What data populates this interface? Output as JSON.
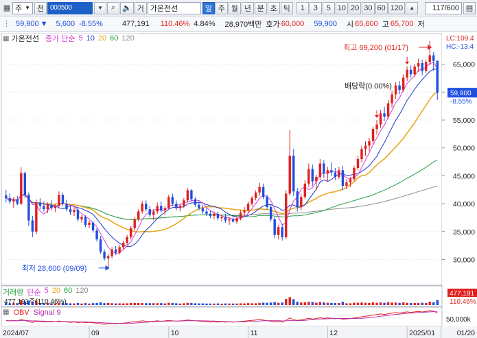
{
  "toolbar": {
    "market": "주",
    "period_label": "전",
    "code": "000500",
    "type": "거",
    "stock_name": "가온전선",
    "periods": [
      "일",
      "주",
      "월",
      "년",
      "분",
      "초",
      "틱"
    ],
    "active_period": "일",
    "intervals": [
      "1",
      "3",
      "5",
      "10",
      "20",
      "30",
      "60",
      "120"
    ],
    "count": "117/600"
  },
  "info": {
    "price": "59,900",
    "change": "5,600",
    "change_pct": "-8.55%",
    "volume": "477,191",
    "vol_ratio": "110.46%",
    "turnover": "4.84%",
    "amount": "28,970백만",
    "ask_label": "호가",
    "ask": "60,000",
    "bid": "59,900",
    "open_label": "시",
    "open": "65,600",
    "high_label": "고",
    "high": "65,700",
    "low_label": "저"
  },
  "legend": {
    "title": "가온전선",
    "ma_label": "종가 단순",
    "ma_periods": [
      "5",
      "10",
      "20",
      "60",
      "120"
    ]
  },
  "annotations": {
    "high": "최고 69,200 (01/17)",
    "low": "최저 28,600 (09/09)",
    "dividend": "배당락(0.00%)",
    "lc": "LC:109.4",
    "hc": "HC:-13.4"
  },
  "price_badge": {
    "price": "59,900",
    "pct": "-8.55%"
  },
  "volume": {
    "title": "거래량",
    "ma_label": "단순",
    "ma_periods": [
      "5",
      "20",
      "60",
      "120"
    ],
    "value_text": "477,191주(110.46%)",
    "badge_value": "477,191",
    "badge_pct": "110.46%"
  },
  "obv": {
    "title": "OBV",
    "signal": "Signal 9",
    "axis_label": "50,000k"
  },
  "colors": {
    "up": "#e0201f",
    "down": "#1f4ee0",
    "ma5": "#d43fd4",
    "ma10": "#2238c8",
    "ma20": "#e8a81c",
    "ma60": "#27a043",
    "ma120": "#8c8c8c"
  },
  "chart_data": {
    "type": "candlestick",
    "y_axis_ticks": [
      30000,
      35000,
      40000,
      45000,
      50000,
      55000,
      60000,
      65000
    ],
    "y_axis_labels": [
      "30,000",
      "35,000",
      "40,000",
      "45,000",
      "50,000",
      "55,000",
      "60,000",
      "65,000"
    ],
    "ylim": [
      26000,
      70000
    ],
    "x_axis_labels": [
      "2024/07",
      "09",
      "10",
      "11",
      "12",
      "2025/01",
      "01/20"
    ],
    "candles": [
      {
        "o": 41500,
        "h": 42500,
        "l": 40200,
        "c": 41000
      },
      {
        "o": 41000,
        "h": 41800,
        "l": 40000,
        "c": 40400
      },
      {
        "o": 40400,
        "h": 41200,
        "l": 39300,
        "c": 40800
      },
      {
        "o": 40800,
        "h": 41400,
        "l": 39700,
        "c": 40000
      },
      {
        "o": 40000,
        "h": 46500,
        "l": 39800,
        "c": 45500
      },
      {
        "o": 45500,
        "h": 45800,
        "l": 41000,
        "c": 41600
      },
      {
        "o": 41600,
        "h": 42000,
        "l": 36000,
        "c": 37000
      },
      {
        "o": 37000,
        "h": 37800,
        "l": 34000,
        "c": 35000
      },
      {
        "o": 35000,
        "h": 40800,
        "l": 34500,
        "c": 40200
      },
      {
        "o": 40200,
        "h": 41000,
        "l": 39000,
        "c": 39600
      },
      {
        "o": 39600,
        "h": 40400,
        "l": 38600,
        "c": 39000
      },
      {
        "o": 39000,
        "h": 40200,
        "l": 38300,
        "c": 39800
      },
      {
        "o": 39800,
        "h": 40600,
        "l": 38800,
        "c": 39200
      },
      {
        "o": 39200,
        "h": 40000,
        "l": 38500,
        "c": 39600
      },
      {
        "o": 39600,
        "h": 42200,
        "l": 39400,
        "c": 41600
      },
      {
        "o": 41600,
        "h": 42000,
        "l": 39600,
        "c": 40000
      },
      {
        "o": 40000,
        "h": 40700,
        "l": 38600,
        "c": 39000
      },
      {
        "o": 39000,
        "h": 39700,
        "l": 38000,
        "c": 38500
      },
      {
        "o": 38500,
        "h": 39400,
        "l": 37800,
        "c": 38900
      },
      {
        "o": 38900,
        "h": 39200,
        "l": 36800,
        "c": 37200
      },
      {
        "o": 37200,
        "h": 38000,
        "l": 36600,
        "c": 37600
      },
      {
        "o": 37600,
        "h": 37900,
        "l": 35800,
        "c": 36200
      },
      {
        "o": 36200,
        "h": 37000,
        "l": 35600,
        "c": 36600
      },
      {
        "o": 36600,
        "h": 36800,
        "l": 34800,
        "c": 35200
      },
      {
        "o": 35200,
        "h": 35600,
        "l": 33200,
        "c": 33600
      },
      {
        "o": 33600,
        "h": 34200,
        "l": 31000,
        "c": 31400
      },
      {
        "o": 31400,
        "h": 31800,
        "l": 29800,
        "c": 30200
      },
      {
        "o": 30200,
        "h": 31000,
        "l": 28600,
        "c": 30600
      },
      {
        "o": 30600,
        "h": 32200,
        "l": 30200,
        "c": 31800
      },
      {
        "o": 31800,
        "h": 32400,
        "l": 30800,
        "c": 31200
      },
      {
        "o": 31200,
        "h": 32600,
        "l": 30900,
        "c": 32200
      },
      {
        "o": 32200,
        "h": 33400,
        "l": 31800,
        "c": 33000
      },
      {
        "o": 33000,
        "h": 34400,
        "l": 32600,
        "c": 34000
      },
      {
        "o": 34000,
        "h": 36000,
        "l": 33600,
        "c": 35600
      },
      {
        "o": 35600,
        "h": 37600,
        "l": 35200,
        "c": 37200
      },
      {
        "o": 37200,
        "h": 39000,
        "l": 36800,
        "c": 38600
      },
      {
        "o": 38600,
        "h": 40500,
        "l": 38200,
        "c": 40000
      },
      {
        "o": 40000,
        "h": 40600,
        "l": 38600,
        "c": 39000
      },
      {
        "o": 39000,
        "h": 39600,
        "l": 37600,
        "c": 38000
      },
      {
        "o": 38000,
        "h": 39000,
        "l": 37000,
        "c": 38600
      },
      {
        "o": 38600,
        "h": 40200,
        "l": 38200,
        "c": 39600
      },
      {
        "o": 39600,
        "h": 40400,
        "l": 38400,
        "c": 38800
      },
      {
        "o": 38800,
        "h": 39600,
        "l": 38000,
        "c": 39200
      },
      {
        "o": 39200,
        "h": 41600,
        "l": 39000,
        "c": 41200
      },
      {
        "o": 41200,
        "h": 41800,
        "l": 39600,
        "c": 40000
      },
      {
        "o": 40000,
        "h": 40600,
        "l": 38800,
        "c": 39200
      },
      {
        "o": 39200,
        "h": 40000,
        "l": 38600,
        "c": 39600
      },
      {
        "o": 39600,
        "h": 41000,
        "l": 39200,
        "c": 40600
      },
      {
        "o": 40600,
        "h": 42800,
        "l": 40200,
        "c": 42400
      },
      {
        "o": 42400,
        "h": 42600,
        "l": 40400,
        "c": 40800
      },
      {
        "o": 40800,
        "h": 41200,
        "l": 39400,
        "c": 39800
      },
      {
        "o": 39800,
        "h": 40400,
        "l": 38800,
        "c": 39200
      },
      {
        "o": 39200,
        "h": 39800,
        "l": 38200,
        "c": 38600
      },
      {
        "o": 38600,
        "h": 39200,
        "l": 37800,
        "c": 38200
      },
      {
        "o": 38200,
        "h": 38800,
        "l": 37400,
        "c": 37800
      },
      {
        "o": 37800,
        "h": 38600,
        "l": 37200,
        "c": 38200
      },
      {
        "o": 38200,
        "h": 38600,
        "l": 37000,
        "c": 37400
      },
      {
        "o": 37400,
        "h": 38000,
        "l": 36800,
        "c": 37600
      },
      {
        "o": 37600,
        "h": 38200,
        "l": 36600,
        "c": 37000
      },
      {
        "o": 37000,
        "h": 37600,
        "l": 36200,
        "c": 37200
      },
      {
        "o": 37200,
        "h": 38000,
        "l": 36600,
        "c": 36800
      },
      {
        "o": 36800,
        "h": 37800,
        "l": 36400,
        "c": 37400
      },
      {
        "o": 37400,
        "h": 38800,
        "l": 37000,
        "c": 38400
      },
      {
        "o": 38400,
        "h": 39400,
        "l": 37800,
        "c": 38800
      },
      {
        "o": 38800,
        "h": 40400,
        "l": 38400,
        "c": 40000
      },
      {
        "o": 40000,
        "h": 41400,
        "l": 39600,
        "c": 41000
      },
      {
        "o": 41000,
        "h": 42400,
        "l": 40600,
        "c": 42000
      },
      {
        "o": 42000,
        "h": 43800,
        "l": 41400,
        "c": 43000
      },
      {
        "o": 43000,
        "h": 43600,
        "l": 40800,
        "c": 41200
      },
      {
        "o": 41200,
        "h": 41600,
        "l": 39000,
        "c": 39400
      },
      {
        "o": 39400,
        "h": 39800,
        "l": 36800,
        "c": 37200
      },
      {
        "o": 37200,
        "h": 37600,
        "l": 33800,
        "c": 34400
      },
      {
        "o": 34400,
        "h": 36200,
        "l": 33600,
        "c": 35800
      },
      {
        "o": 35800,
        "h": 36400,
        "l": 33400,
        "c": 34000
      },
      {
        "o": 34000,
        "h": 42400,
        "l": 33600,
        "c": 41800
      },
      {
        "o": 41800,
        "h": 53200,
        "l": 41400,
        "c": 48600
      },
      {
        "o": 48600,
        "h": 49800,
        "l": 41400,
        "c": 42200
      },
      {
        "o": 42200,
        "h": 42800,
        "l": 38600,
        "c": 39400
      },
      {
        "o": 39400,
        "h": 41800,
        "l": 38800,
        "c": 41200
      },
      {
        "o": 41200,
        "h": 44200,
        "l": 40800,
        "c": 43600
      },
      {
        "o": 43600,
        "h": 47200,
        "l": 43000,
        "c": 46200
      },
      {
        "o": 46200,
        "h": 47000,
        "l": 43200,
        "c": 44000
      },
      {
        "o": 44000,
        "h": 45200,
        "l": 42400,
        "c": 44800
      },
      {
        "o": 44800,
        "h": 48000,
        "l": 44200,
        "c": 47200
      },
      {
        "o": 47200,
        "h": 47800,
        "l": 44600,
        "c": 45400
      },
      {
        "o": 45400,
        "h": 46600,
        "l": 44000,
        "c": 46000
      },
      {
        "o": 46000,
        "h": 47400,
        "l": 45000,
        "c": 45600
      },
      {
        "o": 45600,
        "h": 46400,
        "l": 44200,
        "c": 44800
      },
      {
        "o": 44800,
        "h": 46600,
        "l": 44400,
        "c": 46000
      },
      {
        "o": 46000,
        "h": 46800,
        "l": 42400,
        "c": 43200
      },
      {
        "o": 43200,
        "h": 44400,
        "l": 42600,
        "c": 43800
      },
      {
        "o": 43800,
        "h": 44800,
        "l": 43000,
        "c": 44400
      },
      {
        "o": 44400,
        "h": 46800,
        "l": 44000,
        "c": 46400
      },
      {
        "o": 46400,
        "h": 48600,
        "l": 46000,
        "c": 48000
      },
      {
        "o": 48000,
        "h": 50400,
        "l": 47400,
        "c": 49800
      },
      {
        "o": 49800,
        "h": 51200,
        "l": 48600,
        "c": 50400
      },
      {
        "o": 50400,
        "h": 51800,
        "l": 49400,
        "c": 51200
      },
      {
        "o": 51200,
        "h": 53800,
        "l": 50600,
        "c": 53400
      },
      {
        "o": 53400,
        "h": 55000,
        "l": 52400,
        "c": 54200
      },
      {
        "o": 54200,
        "h": 56800,
        "l": 53600,
        "c": 56200
      },
      {
        "o": 56200,
        "h": 57400,
        "l": 54800,
        "c": 55600
      },
      {
        "o": 55600,
        "h": 58600,
        "l": 55200,
        "c": 58000
      },
      {
        "o": 58000,
        "h": 60200,
        "l": 57200,
        "c": 59600
      },
      {
        "o": 59600,
        "h": 61800,
        "l": 58800,
        "c": 61200
      },
      {
        "o": 61200,
        "h": 62000,
        "l": 59600,
        "c": 60400
      },
      {
        "o": 60400,
        "h": 63200,
        "l": 60000,
        "c": 62600
      },
      {
        "o": 62600,
        "h": 64600,
        "l": 62000,
        "c": 64000
      },
      {
        "o": 64000,
        "h": 64800,
        "l": 62600,
        "c": 63200
      },
      {
        "o": 63200,
        "h": 65000,
        "l": 62800,
        "c": 64600
      },
      {
        "o": 64600,
        "h": 66000,
        "l": 63600,
        "c": 65200
      },
      {
        "o": 65200,
        "h": 65800,
        "l": 63000,
        "c": 63800
      },
      {
        "o": 63800,
        "h": 65800,
        "l": 63400,
        "c": 65400
      },
      {
        "o": 65400,
        "h": 69200,
        "l": 64800,
        "c": 66600
      },
      {
        "o": 66600,
        "h": 67200,
        "l": 63800,
        "c": 65600
      },
      {
        "o": 65600,
        "h": 65700,
        "l": 58600,
        "c": 59900
      }
    ]
  }
}
